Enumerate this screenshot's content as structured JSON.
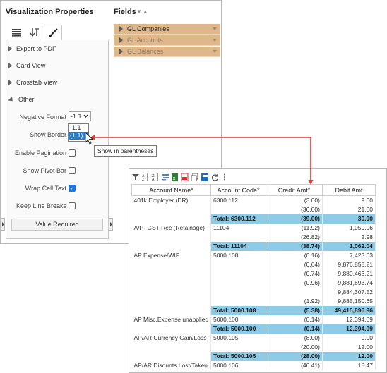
{
  "props": {
    "title": "Visualization Properties",
    "sections": [
      "Export to PDF",
      "Card View",
      "Crosstab View",
      "Other"
    ],
    "negative_format_label": "Negative Format",
    "negative_format_value": "-1.1",
    "dropdown_options": [
      "-1.1",
      "(1.1)"
    ],
    "show_border_label": "Show Border",
    "enable_pagination_label": "Enable Pagination",
    "show_pivot_bar_label": "Show Pivot Bar",
    "wrap_cell_text_label": "Wrap Cell Text",
    "keep_line_breaks_label": "Keep Line Breaks",
    "value_button": "Value Required",
    "tooltip": "Show in parentheses",
    "checks": {
      "enable_pagination": false,
      "show_pivot_bar": false,
      "wrap_cell_text": true,
      "keep_line_breaks": false
    }
  },
  "fields": {
    "title": "Fields",
    "sort_glyph": "▼▲",
    "items": [
      "GL Companies",
      "GL Accounts",
      "GL Balances"
    ]
  },
  "grid": {
    "headers": [
      "Account Name*",
      "Account Code*",
      "Credit Amt*",
      "Debit Amt"
    ],
    "rows": [
      {
        "type": "data",
        "cells": [
          "401k Employer (DR)",
          "6300.112",
          "(3.00)",
          "9.00"
        ]
      },
      {
        "type": "data",
        "cells": [
          "",
          "",
          "(36.00)",
          "21.00"
        ]
      },
      {
        "type": "total",
        "cells": [
          "",
          "Total: 6300.112",
          "(39.00)",
          "30.00"
        ]
      },
      {
        "type": "data",
        "cells": [
          "A/P- GST Rec (Retainage)",
          "11104",
          "(11.92)",
          "1,059.06"
        ]
      },
      {
        "type": "data",
        "cells": [
          "",
          "",
          "(26.82)",
          "2.98"
        ]
      },
      {
        "type": "total",
        "cells": [
          "",
          "Total: 11104",
          "(38.74)",
          "1,062.04"
        ]
      },
      {
        "type": "data",
        "cells": [
          "AP Expense/WIP",
          "5000.108",
          "(0.16)",
          "7,423.63"
        ]
      },
      {
        "type": "data",
        "cells": [
          "",
          "",
          "(0.64)",
          "9,876,858.21"
        ]
      },
      {
        "type": "data",
        "cells": [
          "",
          "",
          "(0.74)",
          "9,880,463.21"
        ]
      },
      {
        "type": "data",
        "cells": [
          "",
          "",
          "(0.96)",
          "9,881,693.74"
        ]
      },
      {
        "type": "data",
        "cells": [
          "",
          "",
          "",
          "9,884,307.52"
        ]
      },
      {
        "type": "data",
        "cells": [
          "",
          "",
          "(1.92)",
          "9,885,150.65"
        ]
      },
      {
        "type": "total",
        "cells": [
          "",
          "Total: 5000.108",
          "(5.38)",
          "49,415,896.96"
        ]
      },
      {
        "type": "data",
        "cells": [
          "AP Misc.Expense unapplied ca",
          "5000.100",
          "(0.14)",
          "12,394.09"
        ]
      },
      {
        "type": "total",
        "cells": [
          "",
          "Total: 5000.100",
          "(0.14)",
          "12,394.09"
        ]
      },
      {
        "type": "data",
        "cells": [
          "AP/AR Currency Gain/Loss",
          "5000.105",
          "(8.00)",
          "0.00"
        ]
      },
      {
        "type": "data",
        "cells": [
          "",
          "",
          "(20.00)",
          "12.00"
        ]
      },
      {
        "type": "total",
        "cells": [
          "",
          "Total: 5000.105",
          "(28.00)",
          "12.00"
        ]
      },
      {
        "type": "data",
        "cells": [
          "AP/AR Disounts Lost/Taken",
          "5000.106",
          "(46.41)",
          "15.47"
        ]
      }
    ]
  },
  "colors": {
    "total_row": "#8dcbe6",
    "field_row": "#dfb78a",
    "arrow": "#e53935",
    "selected_option": "#1e7bd7"
  }
}
